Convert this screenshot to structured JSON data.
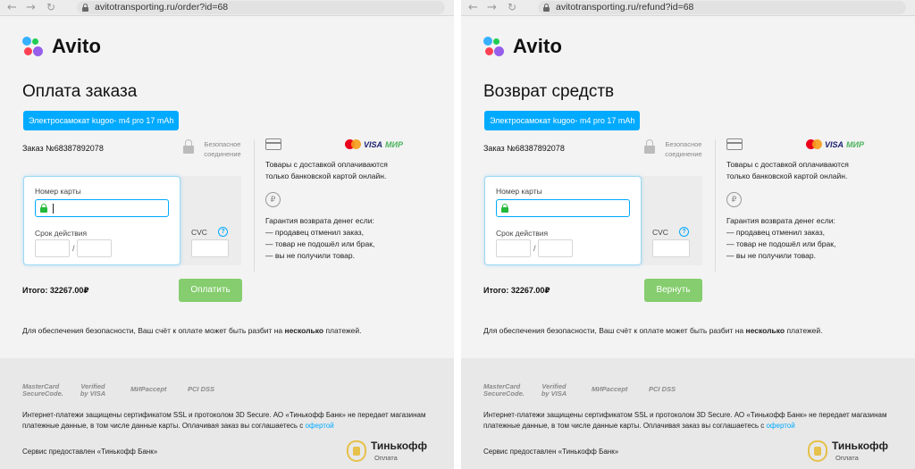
{
  "windows": [
    {
      "url": "avitotransporting.ru/order?id=68",
      "brand": "Avito",
      "page_title": "Оплата заказа",
      "product": "Электросамокат kugoo- m4 pro 17 mAh",
      "order_number": "Заказ №68387892078",
      "secure_label_line1": "Безопасное",
      "secure_label_line2": "соединение",
      "card_number_label": "Номер карты",
      "expiry_label": "Срок действия",
      "expiry_separator": "/",
      "cvc_label": "CVC",
      "cvc_help": "?",
      "card_brands": [
        "VISA",
        "МИР"
      ],
      "delivery_text_line1": "Товары с доставкой оплачиваются",
      "delivery_text_line2": "только банковской картой онлайн.",
      "refund_symbol": "₽",
      "guarantee_title": "Гарантия возврата денег если:",
      "guarantee_items": [
        "— продавец отменил заказ,",
        "— товар не подошёл или брак,",
        "— вы не получили товар."
      ],
      "total": "Итого: 32267.00₽",
      "action_button": "Оплатить",
      "security_note_prefix": "Для обеспечения безопасности, Ваш счёт к оплате может быть разбит на ",
      "security_note_bold": "несколько",
      "security_note_suffix": " платежей.",
      "footer_badges": [
        "MasterCard SecureCode.",
        "Verified by VISA",
        "МИРaccept",
        "PCI DSS"
      ],
      "footer_text_line1": "Интернет-платежи защищены сертификатом SSL и протоколом 3D Secure. АО «Тинькофф Банк» не передает магазинам",
      "footer_text_line2_prefix": "платежные данные, в том числе данные карты. Оплачивая заказ вы соглашаетесь с ",
      "footer_text_link": "офертой",
      "service_provider": "Сервис предоставлен «Тинькофф Банк»",
      "tinkoff_name": "Тинькофф",
      "tinkoff_sub": "Оплата"
    },
    {
      "url": "avitotransporting.ru/refund?id=68",
      "brand": "Avito",
      "page_title": "Возврат средств",
      "product": "Электросамокат kugoo- m4 pro 17 mAh",
      "order_number": "Заказ №68387892078",
      "secure_label_line1": "Безопасное",
      "secure_label_line2": "соединение",
      "card_number_label": "Номер карты",
      "expiry_label": "Срок действия",
      "expiry_separator": "/",
      "cvc_label": "CVC",
      "cvc_help": "?",
      "card_brands": [
        "VISA",
        "МИР"
      ],
      "delivery_text_line1": "Товары с доставкой оплачиваются",
      "delivery_text_line2": "только банковской картой онлайн.",
      "refund_symbol": "₽",
      "guarantee_title": "Гарантия возврата денег если:",
      "guarantee_items": [
        "— продавец отменил заказ,",
        "— товар не подошёл или брак,",
        "— вы не получили товар."
      ],
      "total": "Итого: 32267.00₽",
      "action_button": "Вернуть",
      "security_note_prefix": "Для обеспечения безопасности, Ваш счёт к оплате может быть разбит на ",
      "security_note_bold": "несколько",
      "security_note_suffix": " платежей.",
      "footer_badges": [
        "MasterCard SecureCode.",
        "Verified by VISA",
        "МИРaccept",
        "PCI DSS"
      ],
      "footer_text_line1": "Интернет-платежи защищены сертификатом SSL и протоколом 3D Secure. АО «Тинькофф Банк» не передает магазинам",
      "footer_text_line2_prefix": "платежные данные, в том числе данные карты. Оплачивая заказ вы соглашаетесь с ",
      "footer_text_link": "офертой",
      "service_provider": "Сервис предоставлен «Тинькофф Банк»",
      "tinkoff_name": "Тинькофф",
      "tinkoff_sub": "Оплата"
    }
  ],
  "colors": {
    "accent": "#00aaff",
    "button_green": "#85cd6e",
    "lock_green": "#23b93b",
    "background": "#f3f3f3",
    "footer_bg": "#e8e8e8"
  }
}
